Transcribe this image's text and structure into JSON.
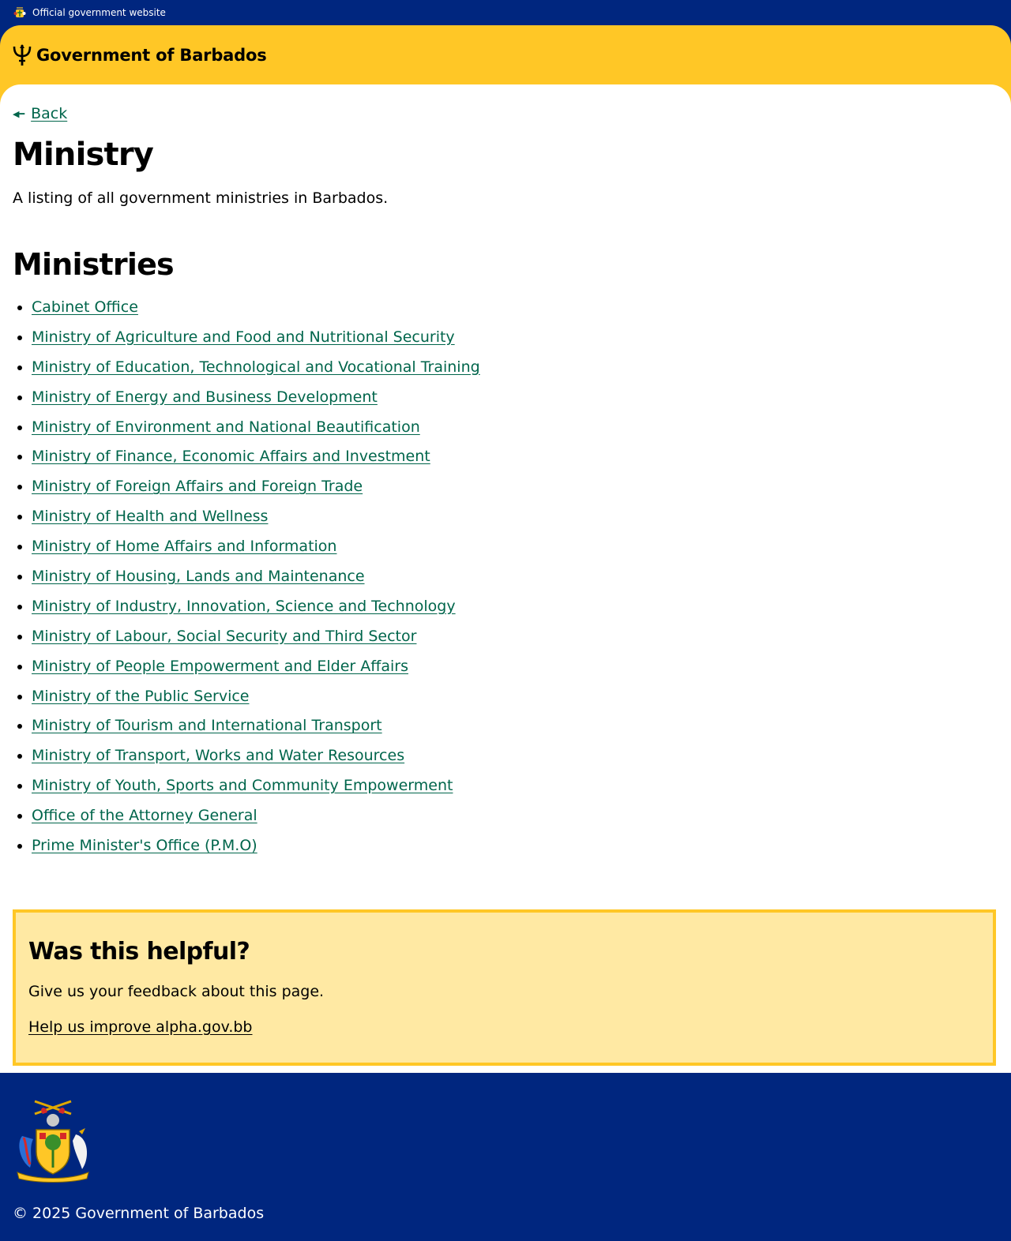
{
  "topbar": {
    "official_text": "Official government website",
    "crest_icon": "coat-of-arms-icon"
  },
  "header": {
    "site_title": "Government of Barbados",
    "logo_icon": "trident-icon"
  },
  "nav": {
    "back_label": "Back",
    "back_icon": "arrow-left-icon"
  },
  "page": {
    "title": "Ministry",
    "lede": "A listing of all government ministries in Barbados.",
    "section_title": "Ministries"
  },
  "ministries": [
    "Cabinet Office",
    "Ministry of Agriculture and Food and Nutritional Security",
    "Ministry of Education, Technological and Vocational Training",
    "Ministry of Energy and Business Development",
    "Ministry of Environment and National Beautification",
    "Ministry of Finance, Economic Affairs and Investment",
    "Ministry of Foreign Affairs and Foreign Trade",
    "Ministry of Health and Wellness",
    "Ministry of Home Affairs and Information",
    "Ministry of Housing, Lands and Maintenance",
    "Ministry of Industry, Innovation, Science and Technology",
    "Ministry of Labour, Social Security and Third Sector",
    "Ministry of People Empowerment and Elder Affairs",
    "Ministry of the Public Service",
    "Ministry of Tourism and International Transport",
    "Ministry of Transport, Works and Water Resources",
    "Ministry of Youth, Sports and Community Empowerment",
    "Office of the Attorney General",
    "Prime Minister's Office (P.M.O)"
  ],
  "feedback": {
    "title": "Was this helpful?",
    "text": "Give us your feedback about this page.",
    "link_label": "Help us improve alpha.gov.bb"
  },
  "footer": {
    "copyright": "© 2025 Government of Barbados",
    "crest_icon": "coat-of-arms-icon"
  },
  "colors": {
    "navy": "#00267f",
    "gold": "#ffc726",
    "link_green": "#00654b",
    "feedback_bg": "#ffe9a3"
  }
}
